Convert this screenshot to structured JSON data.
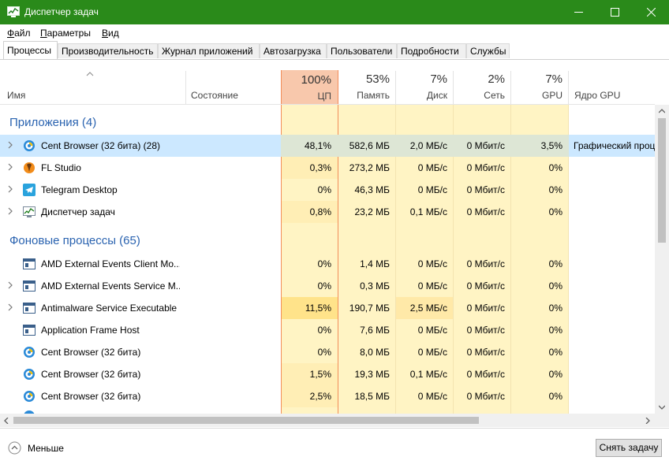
{
  "window": {
    "title": "Диспетчер задач"
  },
  "menu": [
    "Файл",
    "Параметры",
    "Вид"
  ],
  "tabs": [
    "Процессы",
    "Производительность",
    "Журнал приложений",
    "Автозагрузка",
    "Пользователи",
    "Подробности",
    "Службы"
  ],
  "columns": {
    "name": "Имя",
    "status": "Состояние",
    "cpu": {
      "pct": "100%",
      "label": "ЦП"
    },
    "memory": {
      "pct": "53%",
      "label": "Память"
    },
    "disk": {
      "pct": "7%",
      "label": "Диск"
    },
    "network": {
      "pct": "2%",
      "label": "Сеть"
    },
    "gpu": {
      "pct": "7%",
      "label": "GPU"
    },
    "gpu_engine": "Ядро GPU"
  },
  "groups": {
    "apps": "Приложения (4)",
    "background": "Фоновые процессы (65)"
  },
  "apps": [
    {
      "name": "Cent Browser (32 бита) (28)",
      "icon": "cent-browser-icon",
      "cpu": "48,1%",
      "mem": "582,6 МБ",
      "disk": "2,0 МБ/с",
      "net": "0 Мбит/с",
      "gpu": "3,5%",
      "engine": "Графический проц",
      "expand": true
    },
    {
      "name": "FL Studio",
      "icon": "fl-studio-icon",
      "cpu": "0,3%",
      "mem": "273,2 МБ",
      "disk": "0 МБ/с",
      "net": "0 Мбит/с",
      "gpu": "0%",
      "engine": "",
      "expand": true
    },
    {
      "name": "Telegram Desktop",
      "icon": "telegram-icon",
      "cpu": "0%",
      "mem": "46,3 МБ",
      "disk": "0 МБ/с",
      "net": "0 Мбит/с",
      "gpu": "0%",
      "engine": "",
      "expand": true
    },
    {
      "name": "Диспетчер задач",
      "icon": "task-manager-icon",
      "cpu": "0,8%",
      "mem": "23,2 МБ",
      "disk": "0,1 МБ/с",
      "net": "0 Мбит/с",
      "gpu": "0%",
      "engine": "",
      "expand": true
    }
  ],
  "background": [
    {
      "name": "AMD External Events Client Mo...",
      "icon": "service-window-icon",
      "cpu": "0%",
      "mem": "1,4 МБ",
      "disk": "0 МБ/с",
      "net": "0 Мбит/с",
      "gpu": "0%",
      "expand": false
    },
    {
      "name": "AMD External Events Service M...",
      "icon": "service-window-icon",
      "cpu": "0%",
      "mem": "0,3 МБ",
      "disk": "0 МБ/с",
      "net": "0 Мбит/с",
      "gpu": "0%",
      "expand": true
    },
    {
      "name": "Antimalware Service Executable",
      "icon": "service-window-icon",
      "cpu": "11,5%",
      "mem": "190,7 МБ",
      "disk": "2,5 МБ/с",
      "net": "0 Мбит/с",
      "gpu": "0%",
      "expand": true
    },
    {
      "name": "Application Frame Host",
      "icon": "service-window-icon",
      "cpu": "0%",
      "mem": "7,6 МБ",
      "disk": "0 МБ/с",
      "net": "0 Мбит/с",
      "gpu": "0%",
      "expand": false
    },
    {
      "name": "Cent Browser (32 бита)",
      "icon": "cent-browser-icon",
      "cpu": "0%",
      "mem": "8,0 МБ",
      "disk": "0 МБ/с",
      "net": "0 Мбит/с",
      "gpu": "0%",
      "expand": false
    },
    {
      "name": "Cent Browser (32 бита)",
      "icon": "cent-browser-icon",
      "cpu": "1,5%",
      "mem": "19,3 МБ",
      "disk": "0,1 МБ/с",
      "net": "0 Мбит/с",
      "gpu": "0%",
      "expand": false
    },
    {
      "name": "Cent Browser (32 бита)",
      "icon": "cent-browser-icon",
      "cpu": "2,5%",
      "mem": "18,5 МБ",
      "disk": "0 МБ/с",
      "net": "0 Мбит/с",
      "gpu": "0%",
      "expand": false
    }
  ],
  "footer": {
    "less": "Меньше",
    "end_task": "Снять задачу"
  },
  "colors": {
    "titlebar": "#2a8a1a",
    "cpu_header": "#f8c8ac",
    "cpu_border": "#f28d5a",
    "cell_light": "#fff4c4",
    "cell_mid": "#ffe9a8",
    "selected_row": "#cce8ff",
    "group_text": "#2a63b0"
  }
}
